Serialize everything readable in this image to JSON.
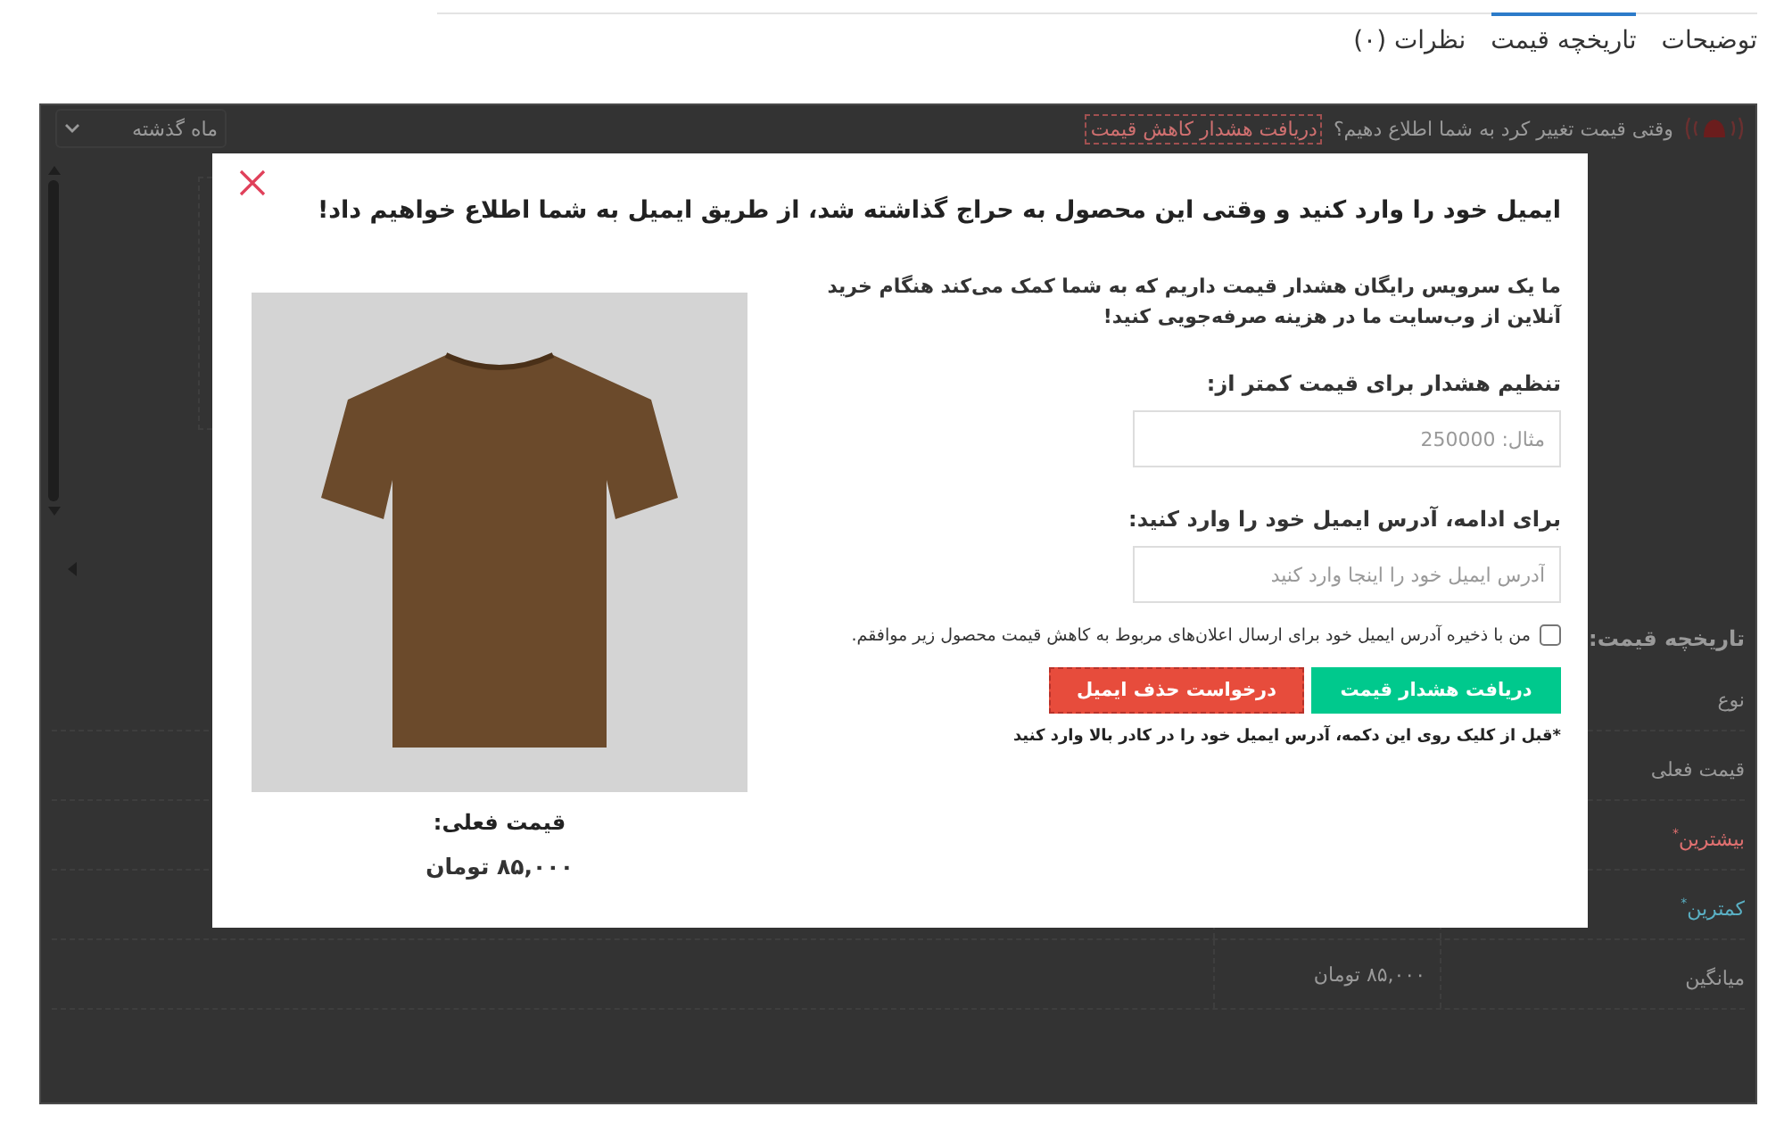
{
  "tabs": [
    {
      "label": "توضیحات",
      "selected": false
    },
    {
      "label": "تاریخچه قیمت",
      "selected": true
    },
    {
      "label": "نظرات (۰)",
      "selected": false
    }
  ],
  "alert_bar": {
    "question": "وقتی قیمت تغییر کرد به شما اطلاع دهیم؟",
    "link": "دریافت هشدار کاهش قیمت"
  },
  "period_select": {
    "value": "ماه گذشته"
  },
  "price_history": {
    "title": "تاریخچه قیمت:",
    "rows": [
      {
        "label": "نوع",
        "kind": "header"
      },
      {
        "label": "قیمت فعلی",
        "kind": "normal"
      },
      {
        "label": "بیشترین$^{*}$",
        "kind": "max"
      },
      {
        "label": "کمترین$^{*}$",
        "kind": "min"
      },
      {
        "label": "میانگین",
        "kind": "normal",
        "value": "۸۵,۰۰۰ تومان"
      }
    ]
  },
  "modal": {
    "title": "ایمیل خود را وارد کنید و وقتی این محصول به حراج گذاشته شد، از طریق ایمیل به شما اطلاع خواهیم داد!",
    "intro": "ما یک سرویس رایگان هشدار قیمت داریم که به شما کمک می‌کند هنگام خرید آنلاین از وب‌سایت ما در هزینه صرفه‌جویی کنید!",
    "price_label": "تنظیم هشدار برای قیمت کمتر از:",
    "price_field": {
      "placeholder": "مثال: 250000"
    },
    "email_label": "برای ادامه، آدرس ایمیل خود را وارد کنید:",
    "email_field": {
      "placeholder": "آدرس ایمیل خود را اینجا وارد کنید"
    },
    "consent": {
      "label": "من با ذخیره آدرس ایمیل خود برای ارسال اعلان‌های مربوط به کاهش قیمت محصول زیر موافقم.",
      "checked": false
    },
    "buttons": [
      {
        "label": "دریافت هشدار قیمت",
        "kind": "primary"
      },
      {
        "label": "درخواست حذف ایمیل",
        "kind": "danger"
      }
    ],
    "note": "*قبل از کلیک روی این دکمه، آدرس ایمیل خود را در کادر بالا وارد کنید",
    "product": {
      "current_price_label": "قیمت فعلی:",
      "current_price": "۸۵,۰۰۰ تومان"
    }
  }
}
